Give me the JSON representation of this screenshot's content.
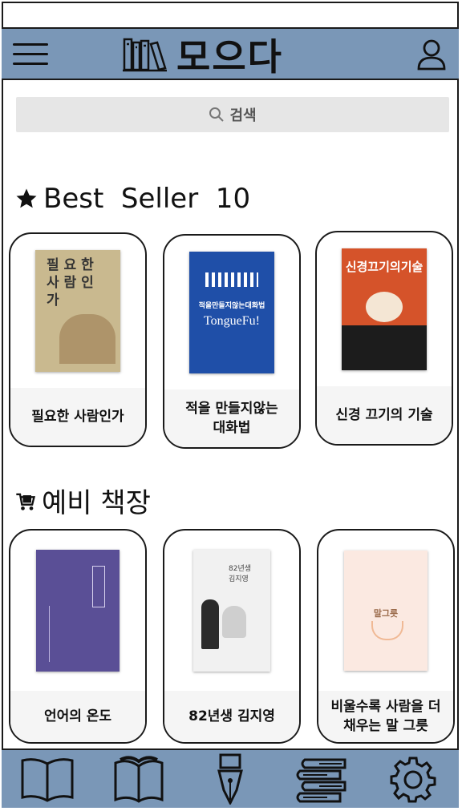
{
  "header": {
    "app_title": "모으다",
    "menu_icon": "hamburger-menu-icon",
    "logo_icon": "bookshelf-icon",
    "profile_icon": "user-profile-icon"
  },
  "search": {
    "label": "검색",
    "icon": "search-icon"
  },
  "best_seller": {
    "icon": "star-icon",
    "title": "Best  Seller  10",
    "books": [
      {
        "title": "필요한 사람인가",
        "cover_color": "#c9b98f"
      },
      {
        "title": "적을 만들지않는\n대화법",
        "cover_color": "#1f4fa8"
      },
      {
        "title": "신경 끄기의 기술",
        "cover_color": "#d5532a"
      }
    ]
  },
  "wishlist": {
    "icon": "shopping-cart-icon",
    "title": "예비 책장",
    "books": [
      {
        "title": "언어의 온도",
        "cover_color": "#5a4f96"
      },
      {
        "title": "82년생 김지영",
        "cover_color": "#f1f1f1"
      },
      {
        "title": "비울수록 사람을\n더 채우는 말 그릇",
        "cover_color": "#fbe9e1"
      }
    ]
  },
  "bottom_nav": [
    {
      "icon": "open-book-outline-icon"
    },
    {
      "icon": "reading-book-icon"
    },
    {
      "icon": "fountain-pen-icon"
    },
    {
      "icon": "book-stack-icon"
    },
    {
      "icon": "settings-gear-icon"
    }
  ]
}
